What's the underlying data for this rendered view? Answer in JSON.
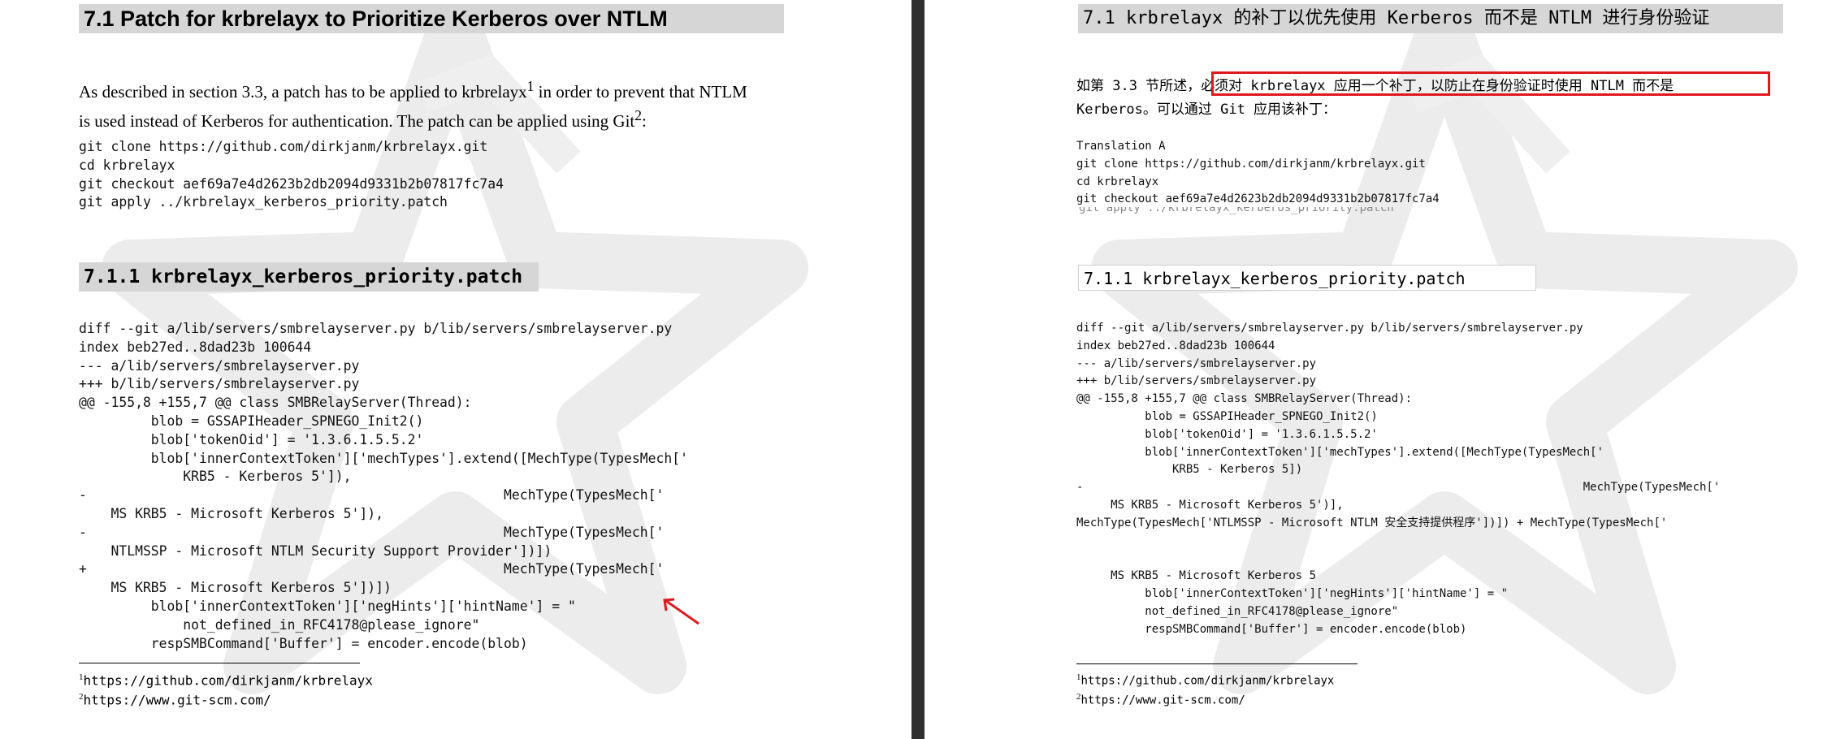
{
  "left": {
    "section_title": "7.1  Patch for krbrelayx to Prioritize Kerberos over NTLM",
    "intro_line1": "As described in section 3.3, a patch has to be applied to krbrelayx",
    "intro_sup1": "1",
    "intro_line1_end": " in order to prevent that NTLM",
    "intro_line2": "is used instead of Kerberos for authentication.  The patch can be applied using Git",
    "intro_sup2": "2",
    "intro_line2_end": ":",
    "git_commands": "git clone https://github.com/dirkjanm/krbrelayx.git\ncd krbrelayx\ngit checkout aef69a7e4d2623b2db2094d9331b2b07817fc7a4\ngit apply ../krbrelayx_kerberos_priority.patch",
    "subsection_title": "7.1.1 krbrelayx_kerberos_priority.patch",
    "patch_code": "diff --git a/lib/servers/smbrelayserver.py b/lib/servers/smbrelayserver.py\nindex beb27ed..8dad23b 100644\n--- a/lib/servers/smbrelayserver.py\n+++ b/lib/servers/smbrelayserver.py\n@@ -155,8 +155,7 @@ class SMBRelayServer(Thread):\n         blob = GSSAPIHeader_SPNEGO_Init2()\n         blob['tokenOid'] = '1.3.6.1.5.5.2'\n         blob['innerContextToken']['mechTypes'].extend([MechType(TypesMech['\n             KRB5 - Kerberos 5']),\n-                                                    MechType(TypesMech['\n    MS KRB5 - Microsoft Kerberos 5']),\n-                                                    MechType(TypesMech['\n    NTLMSSP - Microsoft NTLM Security Support Provider'])])\n+                                                    MechType(TypesMech['\n    MS KRB5 - Microsoft Kerberos 5'])])\n         blob['innerContextToken']['negHints']['hintName'] = \"\n             not_defined_in_RFC4178@please_ignore\"\n         respSMBCommand['Buffer'] = encoder.encode(blob)",
    "footnotes": [
      {
        "num": "1",
        "text": "https://github.com/dirkjanm/krbrelayx"
      },
      {
        "num": "2",
        "text": "https://www.git-scm.com/"
      }
    ]
  },
  "right": {
    "section_title": "7.1 krbrelayx 的补丁以优先使用 Kerberos 而不是 NTLM 进行身份验证",
    "intro_line1_start": "如第 3.3 节所述，",
    "intro_line1_highlight": "必须对 krbrelayx 应用一个补丁，以防止在身份验证时使用 NTLM 而不是",
    "intro_line2": "Kerberos。可以通过 Git 应用该补丁：",
    "git_commands": "Translation A\ngit clone https://github.com/dirkjanm/krbrelayx.git\ncd krbrelayx\ngit checkout aef69a7e4d2623b2db2094d9331b2b07817fc7a4",
    "faded_line": "git apply ../krbrelayx_kerberos_priority.patch",
    "subsection_title": "7.1.1 krbrelayx_kerberos_priority.patch",
    "patch_code": "diff --git a/lib/servers/smbrelayserver.py b/lib/servers/smbrelayserver.py\nindex beb27ed..8dad23b 100644\n--- a/lib/servers/smbrelayserver.py\n+++ b/lib/servers/smbrelayserver.py\n@@ -155,8 +155,7 @@ class SMBRelayServer(Thread):\n          blob = GSSAPIHeader_SPNEGO_Init2()\n          blob['tokenOid'] = '1.3.6.1.5.5.2'\n          blob['innerContextToken']['mechTypes'].extend([MechType(TypesMech['\n              KRB5 - Kerberos 5])\n-                                                                         MechType(TypesMech['\n     MS KRB5 - Microsoft Kerberos 5')],\nMechType(TypesMech['NTLMSSP - Microsoft NTLM 安全支持提供程序'])]) + MechType(TypesMech['\n\n\n     MS KRB5 - Microsoft Kerberos 5\n          blob['innerContextToken']['negHints']['hintName'] = \"\n          not_defined_in_RFC4178@please_ignore\"\n          respSMBCommand['Buffer'] = encoder.encode(blob)",
    "footnotes": [
      {
        "num": "1",
        "text": "https://github.com/dirkjanm/krbrelayx"
      },
      {
        "num": "2",
        "text": "https://www.git-scm.com/"
      }
    ]
  },
  "colors": {
    "heading_bg": "#d6d6d6",
    "highlight_box": "#e0181e",
    "arrow": "#e0181e"
  }
}
